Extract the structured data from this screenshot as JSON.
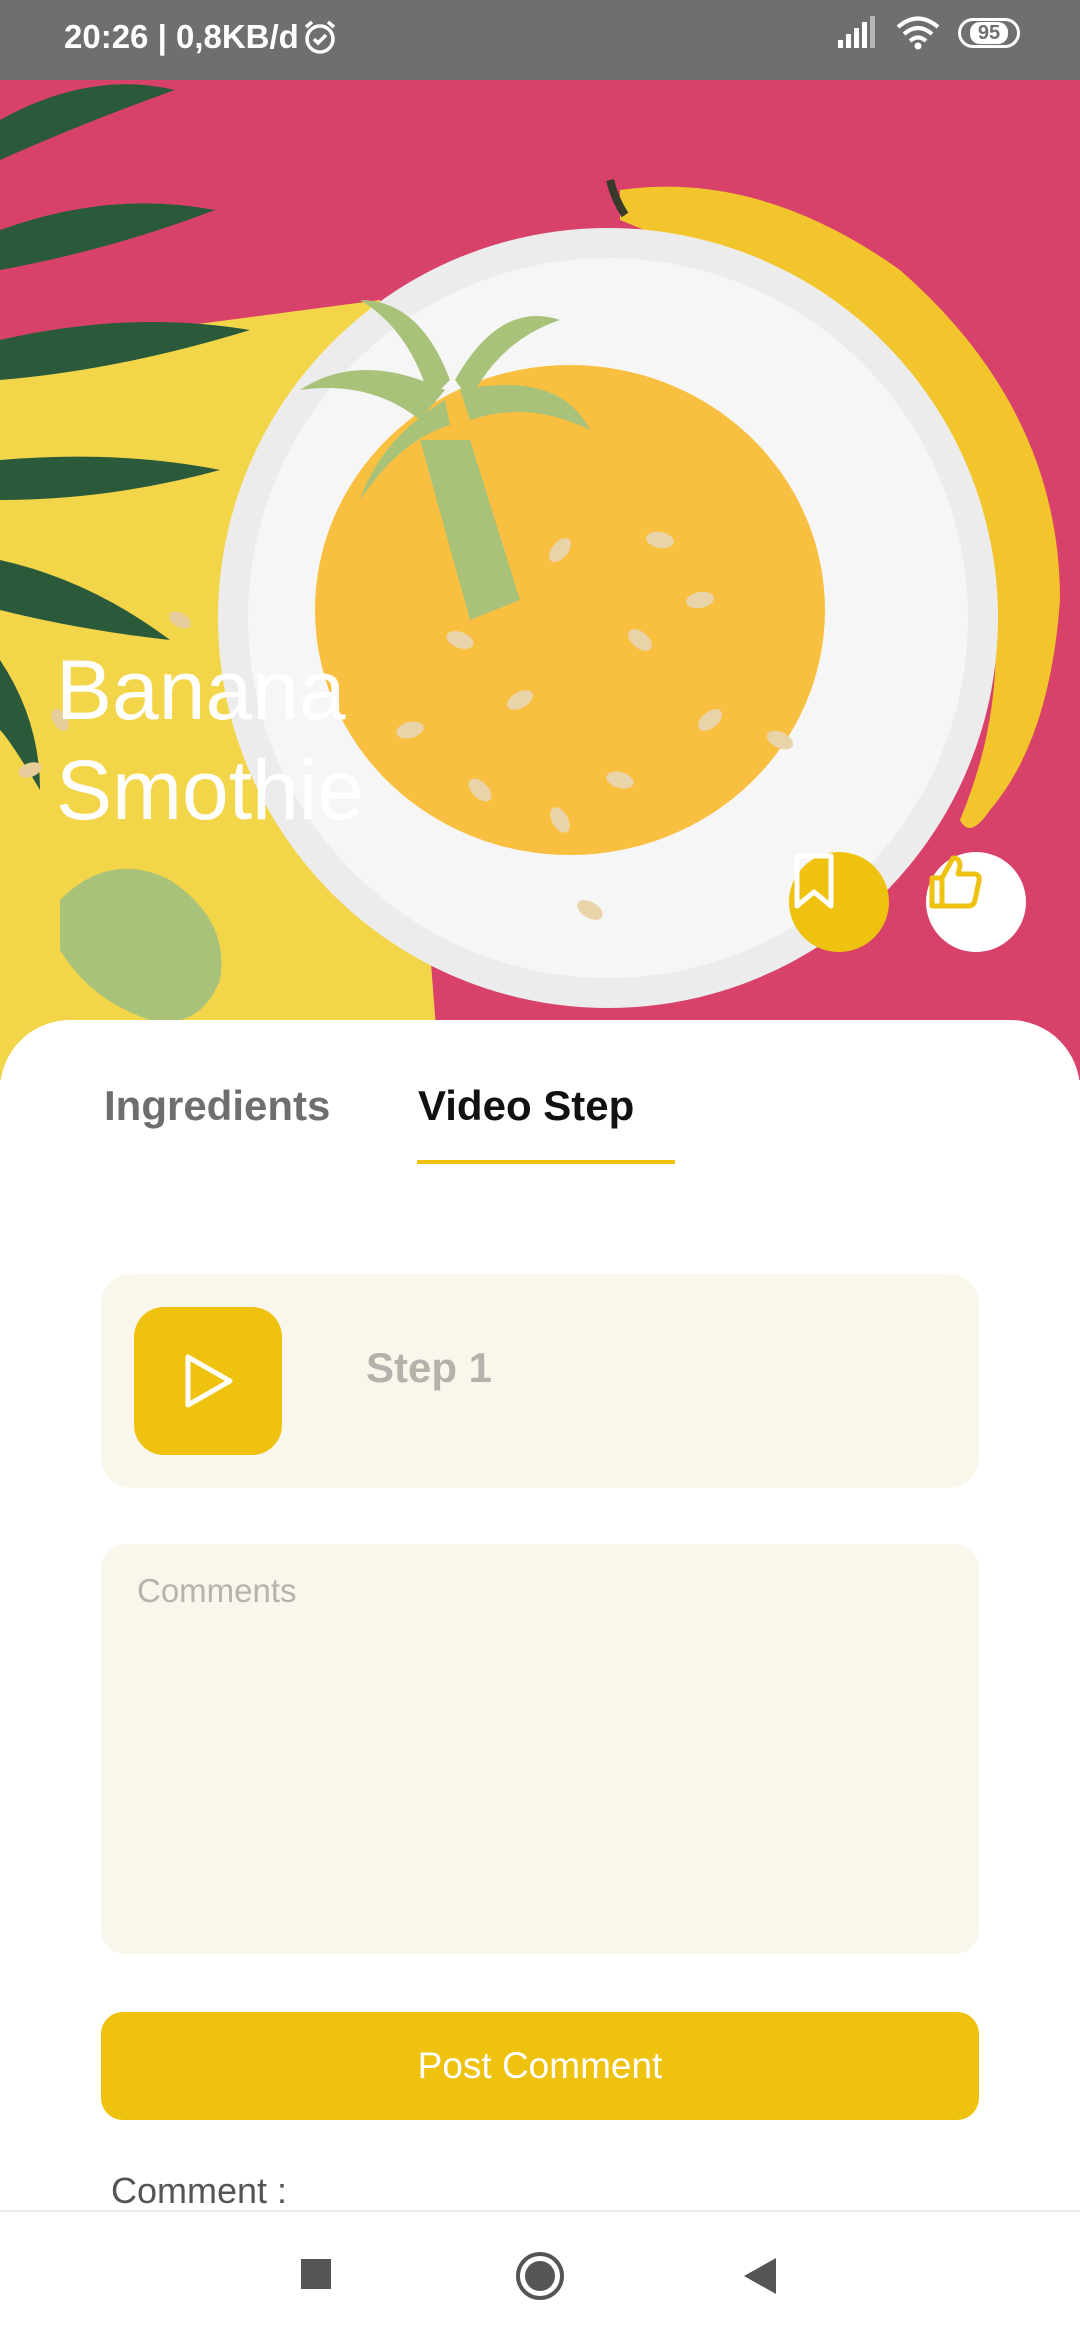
{
  "status_bar": {
    "time_and_speed": "20:26 | 0,8KB/d",
    "battery": "95"
  },
  "hero": {
    "title": "Banana Smothie"
  },
  "tabs": [
    {
      "label": "Ingredients",
      "active": false
    },
    {
      "label": "Video Step",
      "active": true
    }
  ],
  "step": {
    "label": "Step 1"
  },
  "comments": {
    "placeholder": "Comments",
    "value": ""
  },
  "post_button": {
    "label": "Post Comment"
  },
  "comment_section": {
    "label": "Comment :"
  },
  "colors": {
    "accent": "#eec20f",
    "hero_background": "#d8416a",
    "card_background": "#f9f6ec"
  },
  "icons": {
    "bookmark": "bookmark-icon",
    "like": "thumbs-up-icon",
    "play": "play-icon"
  }
}
